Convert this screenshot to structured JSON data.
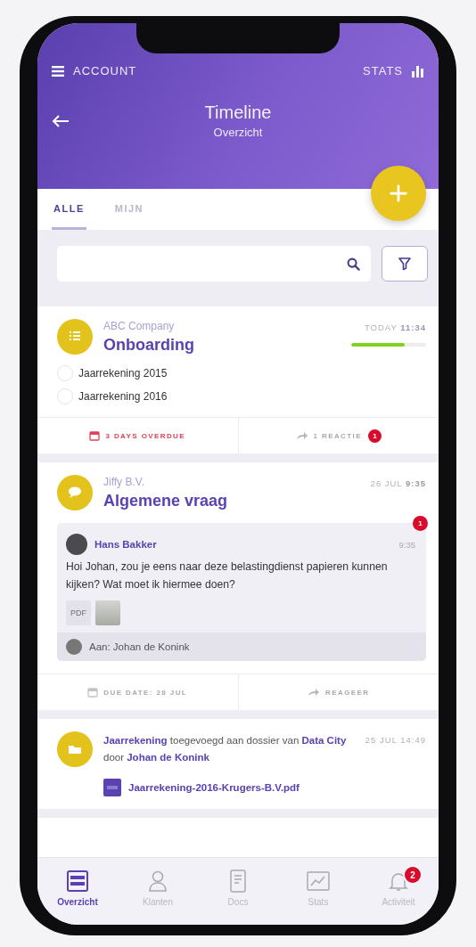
{
  "header": {
    "menu_label": "ACCOUNT",
    "stats_label": "STATS",
    "title": "Timeline",
    "subtitle": "Overzicht"
  },
  "tabs": [
    {
      "label": "ALLE",
      "selected": true
    },
    {
      "label": "MIJN",
      "selected": false
    }
  ],
  "feed": [
    {
      "kind": "task",
      "company": "ABC Company",
      "title": "Onboarding",
      "time": "TODAY **11:34**",
      "progress": {
        "level": 0.72
      },
      "checklist": [
        {
          "label": "Jaarrekening 2015",
          "checked": false
        },
        {
          "label": "Jaarrekening 2016",
          "checked": false
        }
      ],
      "footer": [
        {
          "kind": "due",
          "text": "3 DAYS OVERDUE",
          "overdue": true
        },
        {
          "kind": "reply",
          "text": "1 REACTIE",
          "badge": "1"
        }
      ]
    },
    {
      "kind": "message",
      "company": "Jiffy B.V.",
      "title": "Algemene vraag",
      "time": "26 JUL **9:35**",
      "message": {
        "badge": "1",
        "author": "Hans Bakker",
        "time": "9:35",
        "text": "Hoi Johan, zou je eens naar deze belastingdienst papieren kunnen kijken? Wat moet ik hiermee doen?",
        "attachments": [
          {
            "kind": "pdf",
            "label": "PDF"
          },
          {
            "kind": "image"
          }
        ],
        "recipient": "Aan: Johan de Konink"
      },
      "footer": [
        {
          "kind": "due",
          "text": "DUE DATE: 28 JUL",
          "overdue": false
        },
        {
          "kind": "reply",
          "text": "REAGEER"
        }
      ]
    },
    {
      "kind": "activity",
      "text": "**Jaarrekening** toegevoegd aan dossier van **Data City** door **Johan de Konink**",
      "time": "25 JUL 14:49",
      "file": "Jaarrekening-2016-Krugers-B.V.pdf"
    }
  ],
  "nav": [
    {
      "label": "Overzicht",
      "selected": true
    },
    {
      "label": "Klanten",
      "selected": false
    },
    {
      "label": "Docs",
      "selected": false
    },
    {
      "label": "Stats",
      "selected": false
    },
    {
      "label": "Activiteit",
      "selected": false,
      "badge": "2"
    }
  ]
}
